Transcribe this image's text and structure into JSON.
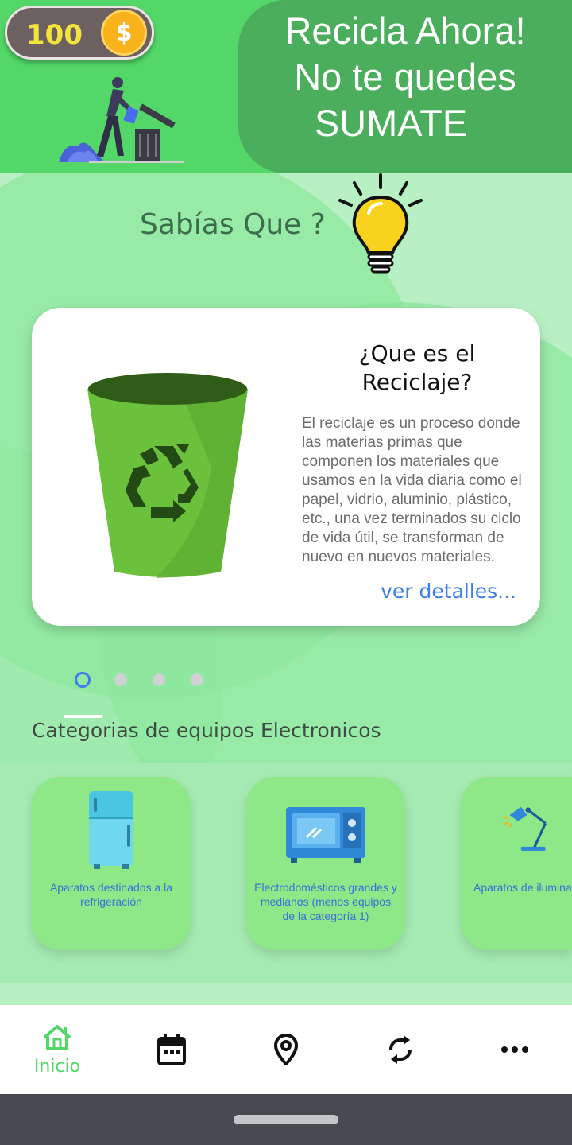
{
  "header": {
    "coins": "100",
    "coin_symbol": "$",
    "slogan": [
      "Recicla Ahora!",
      "No te quedes",
      "SUMATE"
    ]
  },
  "fact_section": {
    "title": "Sabías Que ?"
  },
  "card": {
    "title": "¿Que es el Reciclaje?",
    "body": "El reciclaje es un proceso donde las materias primas que componen los materiales que usamos en la vida diaria como el papel, vidrio, aluminio, plástico, etc., una vez terminados su ciclo de vida útil, se transforman de nuevo en nuevos materiales.",
    "link": "ver detalles..."
  },
  "carousel": {
    "count": 4,
    "active": 0
  },
  "categories": {
    "title": "Categorias de equipos Electronicos",
    "items": [
      {
        "label": "Aparatos destinados a la refrigeración",
        "icon": "fridge-icon"
      },
      {
        "label": "Electrodomésticos grandes y medianos (menos equipos de la categoría 1)",
        "icon": "microwave-icon"
      },
      {
        "label": "Aparatos de iluminación",
        "icon": "lamp-icon"
      }
    ]
  },
  "navbar": {
    "items": [
      {
        "label": "Inicio",
        "icon": "home-icon",
        "active": true
      },
      {
        "label": "",
        "icon": "calendar-icon"
      },
      {
        "label": "",
        "icon": "location-pin-icon"
      },
      {
        "label": "",
        "icon": "refresh-icon"
      },
      {
        "label": "",
        "icon": "more-icon"
      }
    ]
  },
  "colors": {
    "header_green": "#52d768",
    "slogan_green": "#4aae5c",
    "accent_blue": "#3d7fe6",
    "coin_gold": "#f8b21c"
  }
}
